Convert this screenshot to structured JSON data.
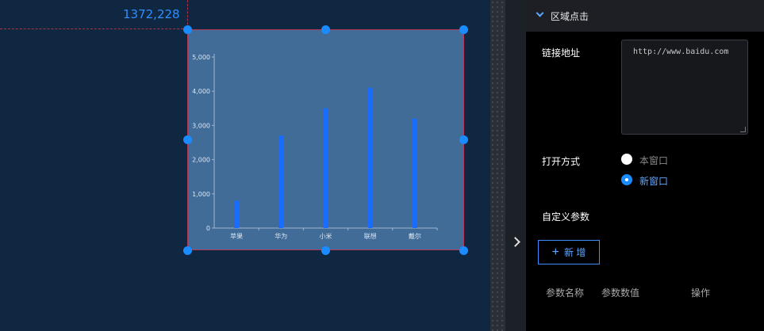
{
  "canvas": {
    "coordinate_readout": "1372,228"
  },
  "chart_data": {
    "type": "bar",
    "categories": [
      "苹果",
      "华为",
      "小米",
      "联想",
      "戴尔"
    ],
    "values": [
      800,
      2700,
      3500,
      4100,
      3200
    ],
    "yticks": [
      "0",
      "1,000",
      "2,000",
      "3,000",
      "4,000",
      "5,000"
    ],
    "ylim": [
      0,
      5000
    ],
    "bar_color": "#1a6cff",
    "axis_color": "#9fb6cf",
    "label_color": "#dbe6f2"
  },
  "panel": {
    "section_title": "区域点击",
    "link_label": "链接地址",
    "link_value": "http://www.baidu.com",
    "open_mode_label": "打开方式",
    "open_options": [
      {
        "label": "本窗口",
        "selected": false
      },
      {
        "label": "新窗口",
        "selected": true
      }
    ],
    "custom_params_label": "自定义参数",
    "add_button_label": "新 增",
    "table_headers": [
      "参数名称",
      "参数数值",
      "操作"
    ]
  },
  "colors": {
    "accent": "#1a8cff",
    "canvas_bg": "#0f2740",
    "panel_bg": "#000000"
  }
}
